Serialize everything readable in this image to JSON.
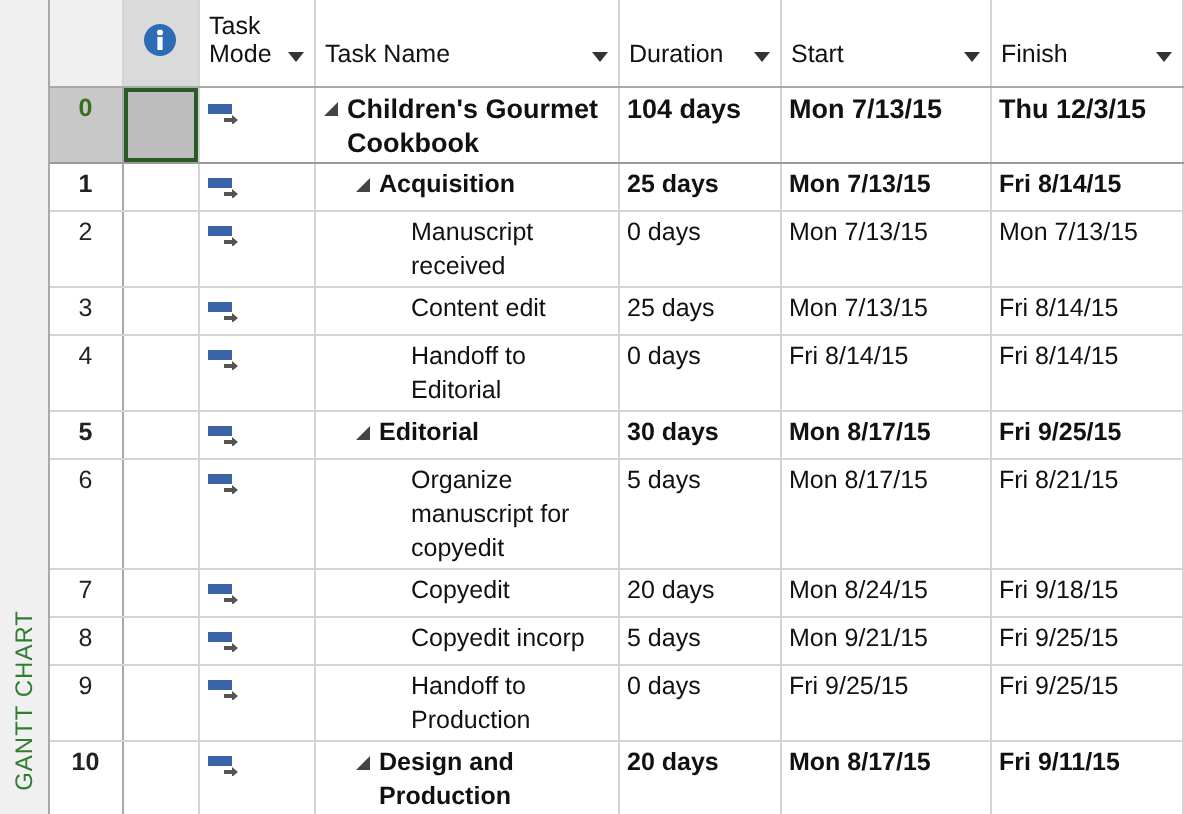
{
  "view_bar": {
    "label": "GANTT CHART"
  },
  "columns": [
    {
      "label": "Task Mode"
    },
    {
      "label": "Task Name"
    },
    {
      "label": "Duration"
    },
    {
      "label": "Start"
    },
    {
      "label": "Finish"
    }
  ],
  "tasks": [
    {
      "id": "0",
      "name": "Children's Gourmet Cookbook",
      "duration": "104 days",
      "start": "Mon 7/13/15",
      "finish": "Thu 12/3/15",
      "selected": true,
      "expanded": true,
      "children": [
        {
          "id": "1",
          "name": "Acquisition",
          "duration": "25 days",
          "start": "Mon 7/13/15",
          "finish": "Fri 8/14/15",
          "selected": false,
          "expanded": true,
          "children": [
            {
              "id": "2",
              "name": "Manuscript received",
              "duration": "0 days",
              "start": "Mon 7/13/15",
              "finish": "Mon 7/13/15",
              "selected": false
            },
            {
              "id": "3",
              "name": "Content edit",
              "duration": "25 days",
              "start": "Mon 7/13/15",
              "finish": "Fri 8/14/15",
              "selected": false
            },
            {
              "id": "4",
              "name": "Handoff to Editorial",
              "duration": "0 days",
              "start": "Fri 8/14/15",
              "finish": "Fri 8/14/15",
              "selected": false
            }
          ]
        },
        {
          "id": "5",
          "name": "Editorial",
          "duration": "30 days",
          "start": "Mon 8/17/15",
          "finish": "Fri 9/25/15",
          "selected": false,
          "expanded": true,
          "children": [
            {
              "id": "6",
              "name": "Organize manuscript for copyedit",
              "duration": "5 days",
              "start": "Mon 8/17/15",
              "finish": "Fri 8/21/15",
              "selected": false
            },
            {
              "id": "7",
              "name": "Copyedit",
              "duration": "20 days",
              "start": "Mon 8/24/15",
              "finish": "Fri 9/18/15",
              "selected": false
            },
            {
              "id": "8",
              "name": "Copyedit incorp",
              "duration": "5 days",
              "start": "Mon 9/21/15",
              "finish": "Fri 9/25/15",
              "selected": false
            },
            {
              "id": "9",
              "name": "Handoff to Production",
              "duration": "0 days",
              "start": "Fri 9/25/15",
              "finish": "Fri 9/25/15",
              "selected": false
            }
          ]
        },
        {
          "id": "10",
          "name": "Design and Production",
          "duration": "20 days",
          "start": "Mon 8/17/15",
          "finish": "Fri 9/11/15",
          "selected": false,
          "expanded": true
        }
      ]
    }
  ]
}
